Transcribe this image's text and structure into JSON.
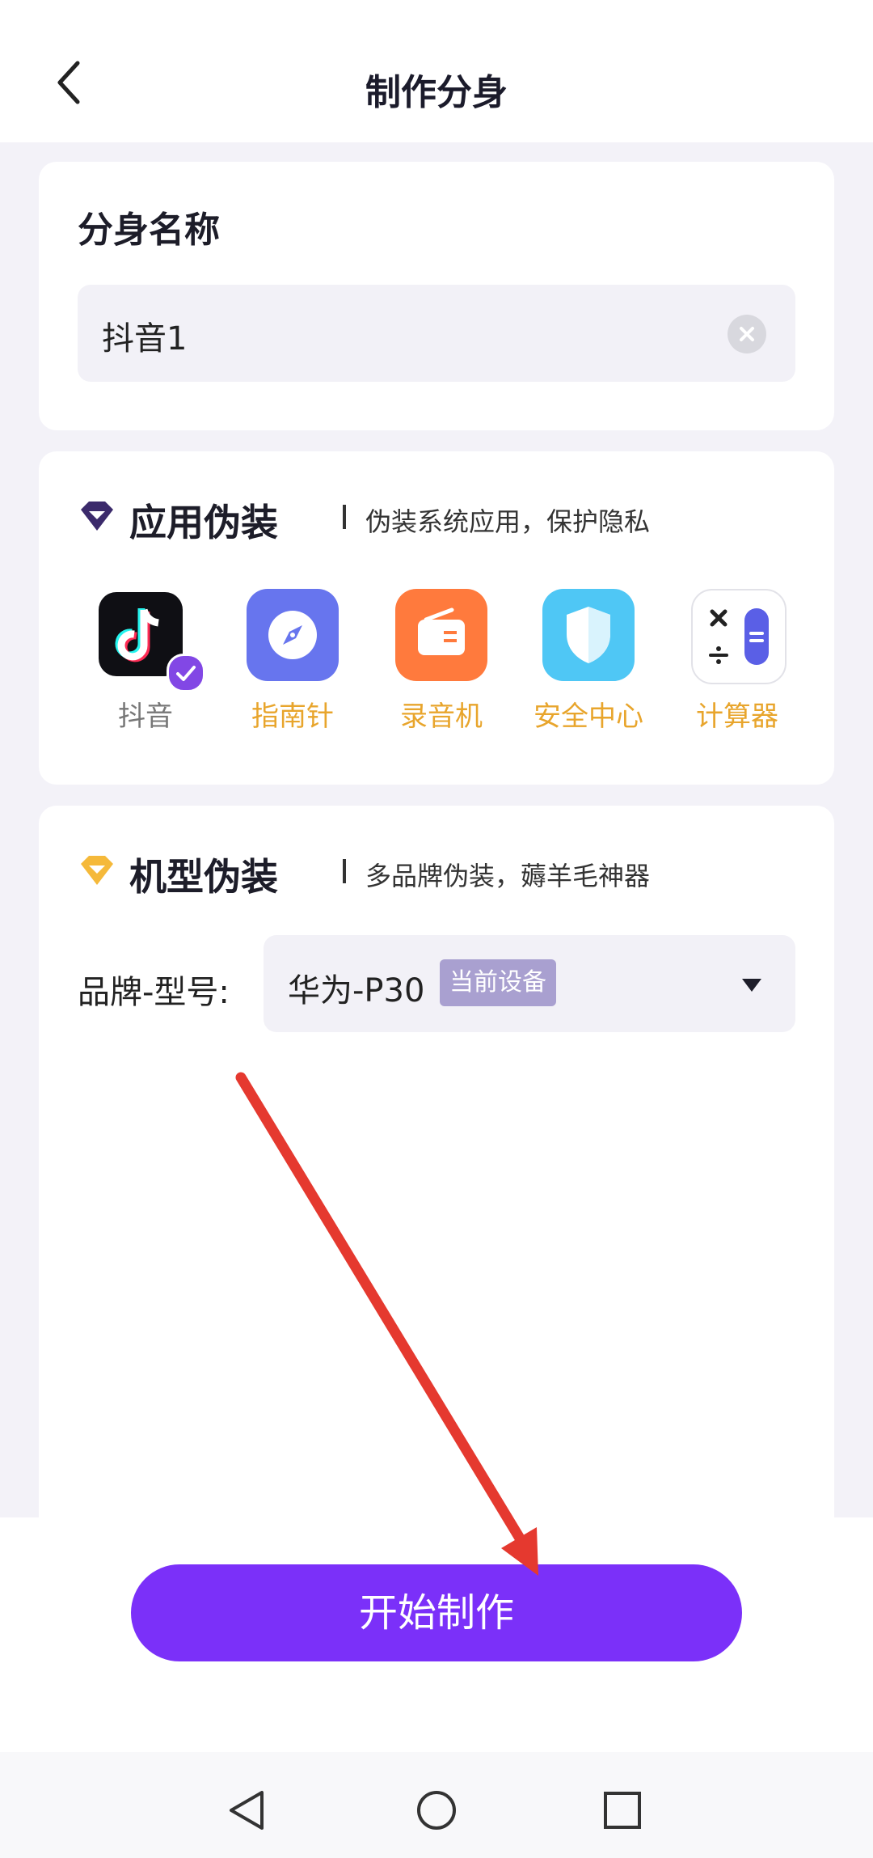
{
  "header": {
    "title": "制作分身"
  },
  "name_card": {
    "title": "分身名称",
    "input_value": "抖音1"
  },
  "app_disguise": {
    "title": "应用伪装",
    "subtitle": "伪装系统应用，保护隐私",
    "apps": [
      {
        "label": "抖音",
        "icon": "tiktok-icon",
        "selected": true
      },
      {
        "label": "指南针",
        "icon": "compass-icon",
        "selected": false
      },
      {
        "label": "录音机",
        "icon": "recorder-icon",
        "selected": false
      },
      {
        "label": "安全中心",
        "icon": "security-center-icon",
        "selected": false
      },
      {
        "label": "计算器",
        "icon": "calculator-icon",
        "selected": false
      }
    ]
  },
  "device_disguise": {
    "title": "机型伪装",
    "subtitle": "多品牌伪装，薅羊毛神器",
    "brand_label": "品牌-型号:",
    "brand_value": "华为-P30",
    "current_badge": "当前设备"
  },
  "start_button": {
    "label": "开始制作"
  },
  "colors": {
    "accent": "#7b30f9",
    "app_label": "#e8a52c",
    "arrow": "#e5392f"
  }
}
